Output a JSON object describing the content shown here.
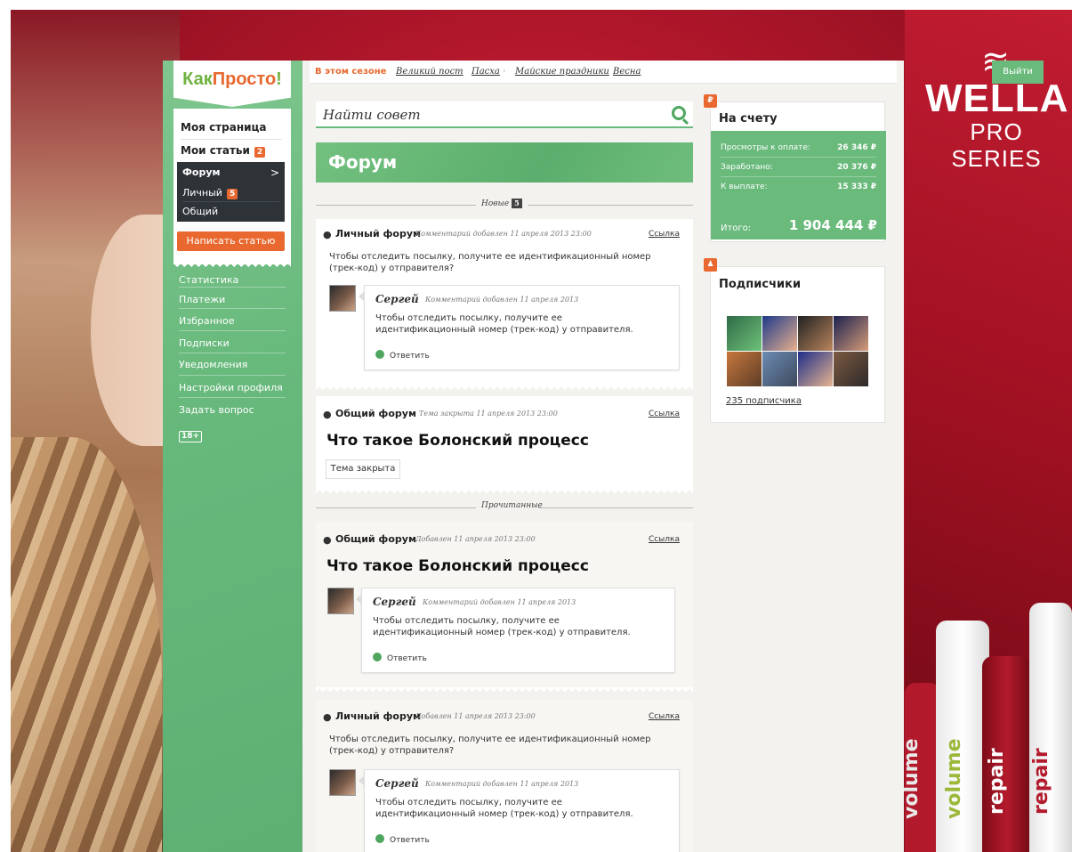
{
  "brand": {
    "logo": "КакПросто!",
    "logo_a": "Как",
    "logo_b": "Просто",
    "logo_c": "!",
    "ad_logo": "WELLA",
    "ad_sub": "PRO SERIES",
    "ad_product_1": "volume",
    "ad_product_2": "repair",
    "ad_product_3": "volume",
    "ad_product_4": "repair"
  },
  "topbar": {
    "season_label": "В этом сезоне",
    "links": [
      "Великий пост",
      "Пасха",
      "Майские праздники",
      "Весна"
    ],
    "logout": "Выйти"
  },
  "sidebar": {
    "white_items": [
      {
        "label": "Моя страница"
      },
      {
        "label": "Мои статьи",
        "badge": "2"
      }
    ],
    "forum": {
      "label": "Форум",
      "sub": [
        {
          "label": "Личный",
          "badge": "5"
        },
        {
          "label": "Общий"
        }
      ]
    },
    "write_button": "Написать статью",
    "links": [
      "Статистика",
      "Платежи",
      "Избранное",
      "Подписки",
      "Уведомления",
      "Настройки профиля",
      "Задать вопрос"
    ],
    "age_badge": "18+"
  },
  "search": {
    "placeholder": "Найти совет"
  },
  "page": {
    "title": "Форум"
  },
  "dividers": {
    "new_label": "Новые",
    "new_count": "5",
    "read_label": "Прочитанные"
  },
  "posts": [
    {
      "forum": "Личный форум",
      "meta": "Комментарий добавлен 11 апреля 2013  23:00",
      "link": "Ссылка",
      "text": "Чтобы отследить посылку, получите ее идентификационный номер (трек-код) у отправителя?",
      "reply": {
        "name": "Сергей",
        "meta": "Комментарий добавлен 11 апреля 2013",
        "text": "Чтобы отследить посылку, получите ее идентификационный номер (трек-код) у отправителя.",
        "button": "Ответить"
      }
    },
    {
      "forum": "Общий форум",
      "meta": "Тема закрыта 11 апреля 2013  23:00",
      "link": "Ссылка",
      "title": "Что такое Болонский процесс",
      "closed": "Тема закрыта"
    },
    {
      "forum": "Общий форум",
      "meta": "Добавлен 11 апреля 2013  23:00",
      "link": "Ссылка",
      "title": "Что такое Болонский процесс",
      "reply": {
        "name": "Сергей",
        "meta": "Комментарий добавлен 11 апреля 2013",
        "text": "Чтобы отследить посылку, получите ее идентификационный номер (трек-код) у отправителя.",
        "button": "Ответить"
      }
    },
    {
      "forum": "Личный форум",
      "meta": "Добавлен 11 апреля 2013  23:00",
      "link": "Ссылка",
      "text": "Чтобы отследить посылку, получите ее идентификационный номер (трек-код) у отправителя?",
      "reply": {
        "name": "Сергей",
        "meta": "Комментарий добавлен 11 апреля 2013",
        "text": "Чтобы отследить посылку, получите ее идентификационный номер (трек-код) у отправителя.",
        "button": "Ответить"
      }
    }
  ],
  "account": {
    "flag": "₽",
    "title": "На счету",
    "rows": [
      {
        "label": "Просмотры к оплате:",
        "value": "26 346 ₽"
      },
      {
        "label": "Заработано:",
        "value": "20 376 ₽"
      },
      {
        "label": "К выплате:",
        "value": "15 333 ₽"
      }
    ],
    "total_label": "Итого:",
    "total_value": "1 904 444 ₽"
  },
  "subscribers": {
    "flag": "♟",
    "title": "Подписчики",
    "count_text": "235 подписчика"
  },
  "colors": {
    "accent": "#6aba7c",
    "orange": "#e8682f",
    "dark": "#2e3338"
  }
}
